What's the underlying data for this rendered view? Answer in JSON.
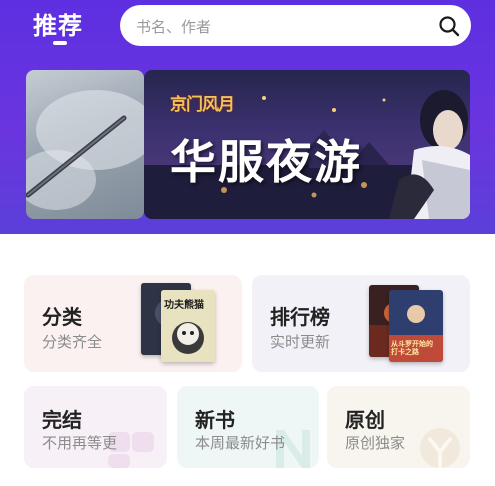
{
  "header": {
    "title": "推荐",
    "search": {
      "placeholder": "书名、作者"
    }
  },
  "banner": {
    "logo_text": "京门风月",
    "title": "华服夜游"
  },
  "cards": [
    {
      "title": "分类",
      "subtitle": "分类齐全",
      "bg": "#fbf1f1"
    },
    {
      "title": "排行榜",
      "subtitle": "实时更新",
      "bg": "#f2f1f8"
    },
    {
      "title": "完结",
      "subtitle": "不用再等更",
      "bg": "#f7f0f7"
    },
    {
      "title": "新书",
      "subtitle": "本周最新好书",
      "bg": "#eef7f6"
    },
    {
      "title": "原创",
      "subtitle": "原创独家",
      "bg": "#f8f4ee"
    }
  ],
  "book_covers": {
    "category_back": "",
    "category_front": "功夫熊猫",
    "rank_back": "",
    "rank_front": "从斗罗开始的 打卡之路"
  },
  "colors": {
    "header_top": "#5d2fe0",
    "header_bottom": "#5b3fd9",
    "title": "#222222",
    "subtitle": "#8c8c8c"
  }
}
